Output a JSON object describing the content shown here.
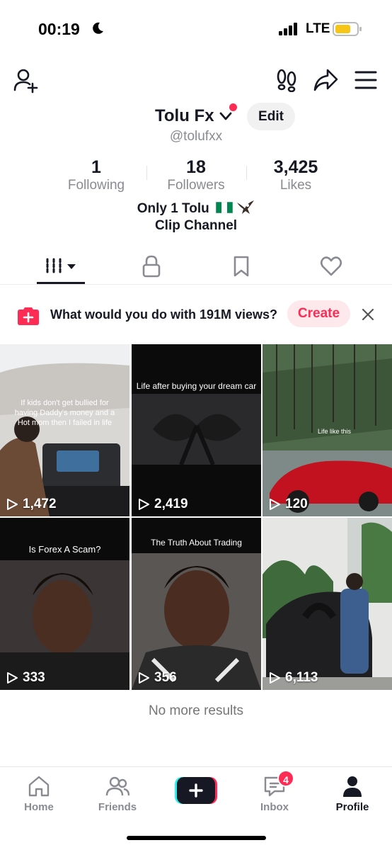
{
  "status_bar": {
    "time": "00:19",
    "network": "LTE",
    "battery_color": "#f5c518"
  },
  "profile": {
    "name": "Tolu Fx",
    "handle": "@tolufxx",
    "edit_label": "Edit",
    "stats": [
      {
        "value": "1",
        "label": "Following"
      },
      {
        "value": "18",
        "label": "Followers"
      },
      {
        "value": "3,425",
        "label": "Likes"
      }
    ],
    "bio_line1": "Only 1 Tolu",
    "bio_line2": "Clip Channel"
  },
  "banner": {
    "text": "What would you do with 191M views?",
    "button_label": "Create"
  },
  "videos": [
    {
      "views": "1,472",
      "caption": "If kids don't get bullied for having Daddy's money and a Hot mom then I failed in life"
    },
    {
      "views": "2,419",
      "caption": "Life after buying your dream car"
    },
    {
      "views": "120",
      "caption": "Life like this"
    },
    {
      "views": "333",
      "caption": "Is Forex A Scam?"
    },
    {
      "views": "356",
      "caption": "The Truth About Trading"
    },
    {
      "views": "6,113",
      "caption": ""
    }
  ],
  "end_text": "No more results",
  "bottom_nav": [
    {
      "label": "Home"
    },
    {
      "label": "Friends"
    },
    {
      "label": "Inbox",
      "badge": "4"
    },
    {
      "label": "Profile"
    }
  ],
  "colors": {
    "accent": "#fe2c55",
    "text": "#161823",
    "muted": "#8a8b91"
  }
}
